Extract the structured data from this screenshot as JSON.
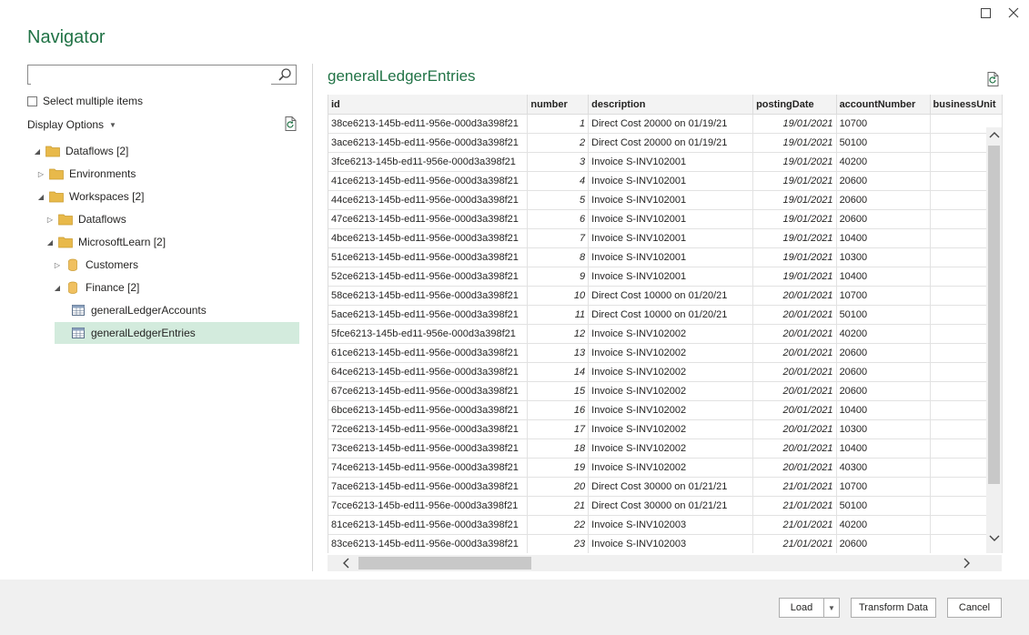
{
  "window": {
    "title": "Navigator"
  },
  "search": {
    "placeholder": ""
  },
  "select_multiple_label": "Select multiple items",
  "display_options_label": "Display Options",
  "tree": [
    {
      "label": "Dataflows [2]",
      "icon": "folder-icon",
      "expander": "expanded"
    },
    {
      "label": "Environments",
      "icon": "folder-icon",
      "expander": "collapsed"
    },
    {
      "label": "Workspaces [2]",
      "icon": "folder-icon",
      "expander": "expanded"
    },
    {
      "label": "Dataflows",
      "icon": "folder-icon",
      "expander": "collapsed"
    },
    {
      "label": "MicrosoftLearn [2]",
      "icon": "folder-icon",
      "expander": "expanded"
    },
    {
      "label": "Customers",
      "icon": "database-icon",
      "expander": "collapsed"
    },
    {
      "label": "Finance [2]",
      "icon": "database-icon",
      "expander": "expanded"
    },
    {
      "label": "generalLedgerAccounts",
      "icon": "table-icon",
      "expander": "none"
    },
    {
      "label": "generalLedgerEntries",
      "icon": "table-icon",
      "expander": "none",
      "selected": true
    }
  ],
  "preview": {
    "title": "generalLedgerEntries",
    "columns": [
      "id",
      "number",
      "description",
      "postingDate",
      "accountNumber",
      "businessUnit"
    ],
    "rows": [
      [
        "38ce6213-145b-ed11-956e-000d3a398f21",
        "1",
        "Direct Cost 20000 on 01/19/21",
        "19/01/2021",
        "10700",
        ""
      ],
      [
        "3ace6213-145b-ed11-956e-000d3a398f21",
        "2",
        "Direct Cost 20000 on 01/19/21",
        "19/01/2021",
        "50100",
        ""
      ],
      [
        "3fce6213-145b-ed11-956e-000d3a398f21",
        "3",
        "Invoice S-INV102001",
        "19/01/2021",
        "40200",
        ""
      ],
      [
        "41ce6213-145b-ed11-956e-000d3a398f21",
        "4",
        "Invoice S-INV102001",
        "19/01/2021",
        "20600",
        ""
      ],
      [
        "44ce6213-145b-ed11-956e-000d3a398f21",
        "5",
        "Invoice S-INV102001",
        "19/01/2021",
        "20600",
        ""
      ],
      [
        "47ce6213-145b-ed11-956e-000d3a398f21",
        "6",
        "Invoice S-INV102001",
        "19/01/2021",
        "20600",
        ""
      ],
      [
        "4bce6213-145b-ed11-956e-000d3a398f21",
        "7",
        "Invoice S-INV102001",
        "19/01/2021",
        "10400",
        ""
      ],
      [
        "51ce6213-145b-ed11-956e-000d3a398f21",
        "8",
        "Invoice S-INV102001",
        "19/01/2021",
        "10300",
        ""
      ],
      [
        "52ce6213-145b-ed11-956e-000d3a398f21",
        "9",
        "Invoice S-INV102001",
        "19/01/2021",
        "10400",
        ""
      ],
      [
        "58ce6213-145b-ed11-956e-000d3a398f21",
        "10",
        "Direct Cost 10000 on 01/20/21",
        "20/01/2021",
        "10700",
        ""
      ],
      [
        "5ace6213-145b-ed11-956e-000d3a398f21",
        "11",
        "Direct Cost 10000 on 01/20/21",
        "20/01/2021",
        "50100",
        ""
      ],
      [
        "5fce6213-145b-ed11-956e-000d3a398f21",
        "12",
        "Invoice S-INV102002",
        "20/01/2021",
        "40200",
        ""
      ],
      [
        "61ce6213-145b-ed11-956e-000d3a398f21",
        "13",
        "Invoice S-INV102002",
        "20/01/2021",
        "20600",
        ""
      ],
      [
        "64ce6213-145b-ed11-956e-000d3a398f21",
        "14",
        "Invoice S-INV102002",
        "20/01/2021",
        "20600",
        ""
      ],
      [
        "67ce6213-145b-ed11-956e-000d3a398f21",
        "15",
        "Invoice S-INV102002",
        "20/01/2021",
        "20600",
        ""
      ],
      [
        "6bce6213-145b-ed11-956e-000d3a398f21",
        "16",
        "Invoice S-INV102002",
        "20/01/2021",
        "10400",
        ""
      ],
      [
        "72ce6213-145b-ed11-956e-000d3a398f21",
        "17",
        "Invoice S-INV102002",
        "20/01/2021",
        "10300",
        ""
      ],
      [
        "73ce6213-145b-ed11-956e-000d3a398f21",
        "18",
        "Invoice S-INV102002",
        "20/01/2021",
        "10400",
        ""
      ],
      [
        "74ce6213-145b-ed11-956e-000d3a398f21",
        "19",
        "Invoice S-INV102002",
        "20/01/2021",
        "40300",
        ""
      ],
      [
        "7ace6213-145b-ed11-956e-000d3a398f21",
        "20",
        "Direct Cost 30000 on 01/21/21",
        "21/01/2021",
        "10700",
        ""
      ],
      [
        "7cce6213-145b-ed11-956e-000d3a398f21",
        "21",
        "Direct Cost 30000 on 01/21/21",
        "21/01/2021",
        "50100",
        ""
      ],
      [
        "81ce6213-145b-ed11-956e-000d3a398f21",
        "22",
        "Invoice S-INV102003",
        "21/01/2021",
        "40200",
        ""
      ],
      [
        "83ce6213-145b-ed11-956e-000d3a398f21",
        "23",
        "Invoice S-INV102003",
        "21/01/2021",
        "20600",
        ""
      ]
    ]
  },
  "footer": {
    "load_label": "Load",
    "transform_label": "Transform Data",
    "cancel_label": "Cancel"
  },
  "colors": {
    "accent": "#217346",
    "selection": "#d3ebdd",
    "folder": "#e8b94a",
    "database": "#f0c060"
  }
}
